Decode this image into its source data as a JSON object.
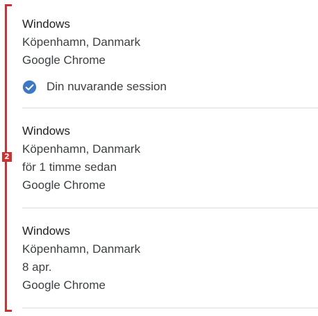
{
  "annotation": {
    "step_number": "2",
    "accent_color": "#d32f2f"
  },
  "sessions": [
    {
      "os": "Windows",
      "location": "Köpenhamn, Danmark",
      "browser": "Google Chrome",
      "current_session_label": "Din nuvarande session",
      "current_icon": "check-circle-icon",
      "current_icon_color": "#3b78c6"
    },
    {
      "os": "Windows",
      "location": "Köpenhamn, Danmark",
      "last_active": "för 1 timme sedan",
      "browser": "Google Chrome"
    },
    {
      "os": "Windows",
      "location": "Köpenhamn, Danmark",
      "last_active": "8 apr.",
      "browser": "Google Chrome"
    }
  ]
}
